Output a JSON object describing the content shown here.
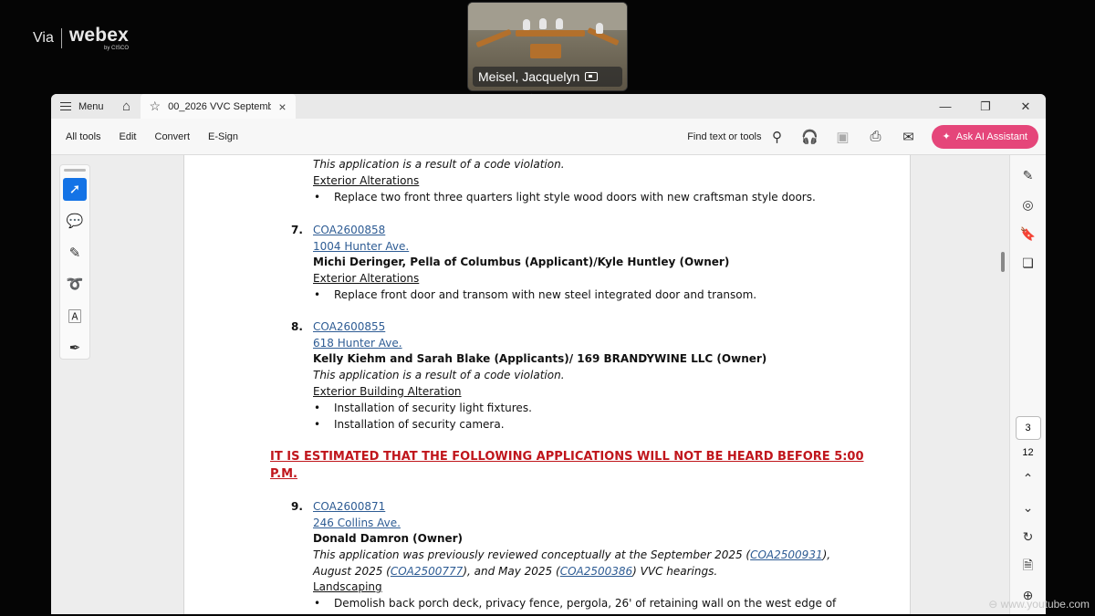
{
  "branding": {
    "via": "Via",
    "logo": "webex",
    "sub": "by CISCO"
  },
  "video": {
    "participant_name": "Meisel, Jacquelyn"
  },
  "window": {
    "menu_label": "Menu",
    "tab_title": "00_2026 VVC Septemb...",
    "controls": {
      "minimize": "—",
      "restore": "❐",
      "close": "✕"
    }
  },
  "toolbar": {
    "items": [
      "All tools",
      "Edit",
      "Convert",
      "E-Sign"
    ],
    "search_label": "Find text or tools",
    "ask_ai_label": "Ask AI Assistant"
  },
  "pager": {
    "current": "3",
    "total": "12"
  },
  "document": {
    "top": {
      "note": "This application is a result of a code violation.",
      "category": "Exterior Alterations",
      "bullet": "Replace two front three quarters light style wood doors with new craftsman style doors."
    },
    "items": [
      {
        "num": "7.",
        "case": "COA2600858",
        "address": "1004 Hunter Ave.",
        "parties": "Michi Deringer, Pella of Columbus (Applicant)/Kyle Huntley (Owner)",
        "category": "Exterior Alterations",
        "bullets": [
          "Replace front door and transom with new steel integrated door and transom."
        ]
      },
      {
        "num": "8.",
        "case": "COA2600855",
        "address": "618 Hunter Ave.",
        "parties": "Kelly Kiehm and Sarah Blake (Applicants)/ 169 BRANDYWINE LLC (Owner)",
        "note": "This application is a result of a code violation.",
        "category": "Exterior Building Alteration",
        "bullets": [
          "Installation of security light fixtures.",
          "Installation of security camera."
        ]
      }
    ],
    "notice_line1": "IT IS ESTIMATED THAT THE FOLLOWING APPLICATIONS WILL NOT BE HEARD BEFORE 5:00",
    "notice_line2": "P.M.",
    "item9": {
      "num": "9.",
      "case": "COA2600871",
      "address": "246 Collins Ave.",
      "parties": "Donald Damron (Owner)",
      "note_a": "This application was previously reviewed conceptually at the September 2025 (",
      "ref1": "COA2500931",
      "note_b": "),",
      "note_c": "August 2025 (",
      "ref2": "COA2500777",
      "note_d": "), and May 2025 (",
      "ref3": "COA2500386",
      "note_e": ") VVC hearings.",
      "category": "Landscaping",
      "bullet": "Demolish back porch deck, privacy fence, pergola, 26' of retaining wall on the west edge of"
    }
  },
  "watermark": "www.youtube.com"
}
